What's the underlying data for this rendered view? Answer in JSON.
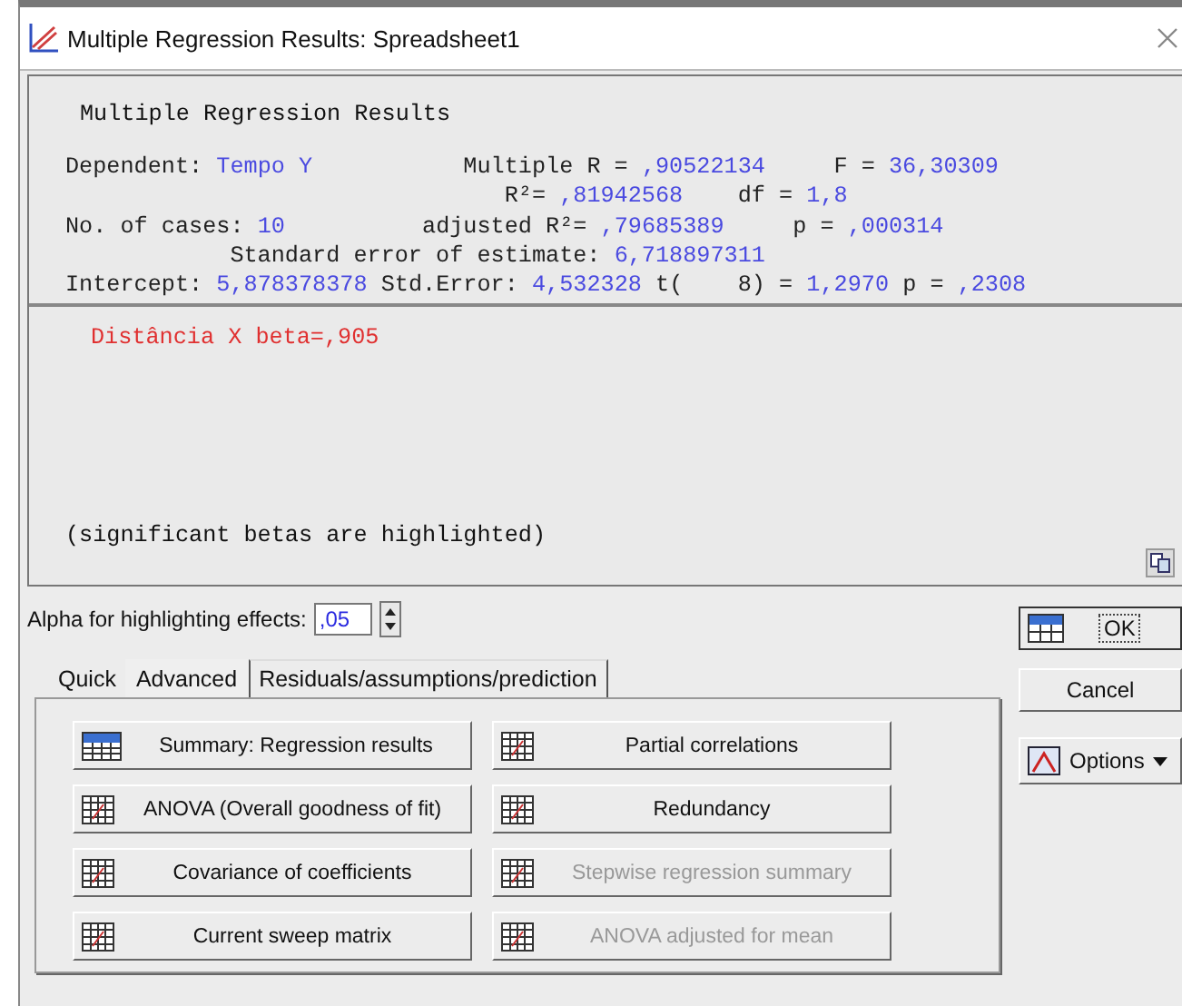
{
  "window": {
    "title": "Multiple Regression Results: Spreadsheet1"
  },
  "results": {
    "heading": "Multiple Regression Results",
    "lines": [
      {
        "segments": [
          {
            "text": "Dependent: ",
            "kind": "label"
          },
          {
            "text": "Tempo Y",
            "kind": "value"
          },
          {
            "text": "           Multiple R = ",
            "kind": "label"
          },
          {
            "text": ",90522134",
            "kind": "value"
          },
          {
            "text": "     F = ",
            "kind": "label"
          },
          {
            "text": "36,30309",
            "kind": "value"
          }
        ]
      },
      {
        "segments": [
          {
            "text": "                                R²= ",
            "kind": "label"
          },
          {
            "text": ",81942568",
            "kind": "value"
          },
          {
            "text": "    df = ",
            "kind": "label"
          },
          {
            "text": "1,8",
            "kind": "value"
          }
        ]
      },
      {
        "segments": [
          {
            "text": "No. of cases: ",
            "kind": "label"
          },
          {
            "text": "10",
            "kind": "value"
          },
          {
            "text": "          adjusted R²= ",
            "kind": "label"
          },
          {
            "text": ",79685389",
            "kind": "value"
          },
          {
            "text": "     p = ",
            "kind": "label"
          },
          {
            "text": ",000314",
            "kind": "value"
          }
        ]
      },
      {
        "segments": [
          {
            "text": "            Standard error of estimate: ",
            "kind": "label"
          },
          {
            "text": "6,718897311",
            "kind": "value"
          }
        ]
      },
      {
        "segments": [
          {
            "text": "Intercept: ",
            "kind": "label"
          },
          {
            "text": "5,878378378",
            "kind": "value"
          },
          {
            "text": " Std.Error: ",
            "kind": "label"
          },
          {
            "text": "4,532328",
            "kind": "value"
          },
          {
            "text": " t(    8) = ",
            "kind": "label"
          },
          {
            "text": "1,2970",
            "kind": "value"
          },
          {
            "text": " p = ",
            "kind": "label"
          },
          {
            "text": ",2308",
            "kind": "value"
          }
        ]
      }
    ],
    "highlighted": [
      {
        "text": "Distância X beta=,905"
      }
    ],
    "note": "(significant betas are highlighted)"
  },
  "alpha": {
    "label": "Alpha for highlighting effects:",
    "value": ",05"
  },
  "tabs": [
    {
      "label": "Quick",
      "selected": false
    },
    {
      "label": "Advanced",
      "selected": true
    },
    {
      "label": "Residuals/assumptions/prediction",
      "selected": false
    }
  ],
  "buttons": [
    {
      "label": "Summary:  Regression results",
      "kind": "summary",
      "disabled": false
    },
    {
      "label": "Partial correlations",
      "kind": "table",
      "disabled": false
    },
    {
      "label": "ANOVA (Overall goodness of fit)",
      "kind": "table",
      "disabled": false
    },
    {
      "label": "Redundancy",
      "kind": "table",
      "disabled": false
    },
    {
      "label": "Covariance of coefficients",
      "kind": "table",
      "disabled": false
    },
    {
      "label": "Stepwise regression summary",
      "kind": "table",
      "disabled": true
    },
    {
      "label": "Current sweep matrix",
      "kind": "table",
      "disabled": false
    },
    {
      "label": "ANOVA adjusted for mean",
      "kind": "table",
      "disabled": true
    }
  ],
  "side_buttons": [
    {
      "label": "OK",
      "kind": "ok"
    },
    {
      "label": "Cancel",
      "kind": "plain"
    },
    {
      "label": "Options",
      "kind": "dropdown"
    }
  ]
}
